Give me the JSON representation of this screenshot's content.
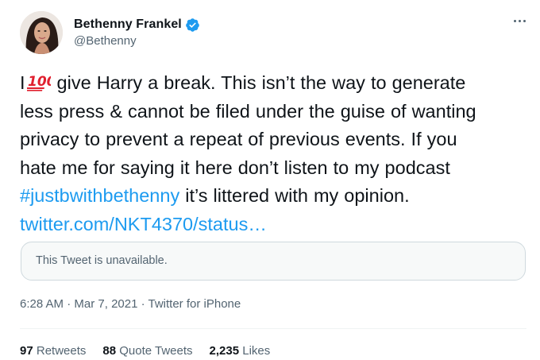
{
  "author": {
    "name": "Bethenny Frankel",
    "handle": "@Bethenny",
    "verified": true
  },
  "tweet": {
    "lines": [
      {
        "before": "I",
        "emoji": "hundred-points-emoji",
        "after": " give Harry a break.  This isn’t the way to generate"
      },
      {
        "text": "less press & cannot be filed under the guise of wanting"
      },
      {
        "text": "privacy to prevent a repeat of previous events. If you"
      },
      {
        "text": "hate me for saying it here don’t listen to my podcast"
      },
      {
        "hashtag": "#justbwithbethenny",
        "after": " it’s littered with my opinion."
      },
      {
        "link": "twitter.com/NKT4370/status…"
      }
    ]
  },
  "quote": {
    "text": "This Tweet is unavailable."
  },
  "meta": {
    "time": "6:28 AM",
    "sep1": " · ",
    "date": "Mar 7, 2021",
    "sep2": " · ",
    "source": "Twitter for iPhone"
  },
  "stats": [
    {
      "count": "97",
      "label": "Retweets"
    },
    {
      "count": "88",
      "label": "Quote Tweets"
    },
    {
      "count": "2,235",
      "label": "Likes"
    }
  ],
  "colors": {
    "accent": "#1d9bf0",
    "text": "#0f1419",
    "secondary": "#536471",
    "border": "#cfd9de",
    "emoji_red": "#e0202f"
  },
  "icons": {
    "verified": "verified-badge-icon",
    "more": "more-options-icon",
    "emoji": "hundred-points-emoji"
  }
}
